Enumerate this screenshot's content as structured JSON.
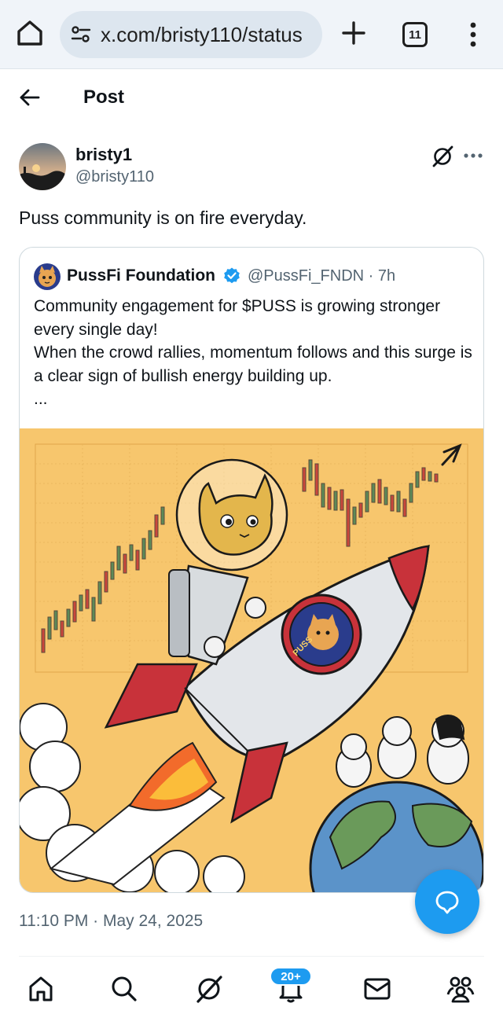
{
  "browser": {
    "url": "x.com/bristy110/status",
    "tab_count": "11"
  },
  "header": {
    "title": "Post"
  },
  "post": {
    "display_name": "bristy1",
    "handle": "@bristy110",
    "text": "Puss community is on fire everyday.",
    "timestamp": "11:10 PM · May 24, 2025"
  },
  "quote": {
    "display_name": "PussFi Foundation",
    "handle_time": "@PussFi_FNDN · 7h",
    "lines": [
      "Community engagement for $PUSS is growing stronger every single day!",
      "When the crowd rallies, momentum follows and this surge is a clear sign of bullish energy building up.",
      "..."
    ],
    "image_badge_text": "PUSS"
  },
  "nav": {
    "notifications_badge": "20+"
  },
  "colors": {
    "accent": "#1d9bf0",
    "text_primary": "#0f1419",
    "text_secondary": "#536471",
    "image_background": "#f7c66d"
  },
  "icons": [
    "home-icon",
    "tune-icon",
    "plus-icon",
    "tabs-icon",
    "overflow-menu-icon",
    "back-arrow-icon",
    "grok-icon",
    "more-icon",
    "verified-badge-icon",
    "compose-message-icon",
    "search-icon",
    "bell-icon",
    "mail-icon",
    "communities-icon"
  ]
}
